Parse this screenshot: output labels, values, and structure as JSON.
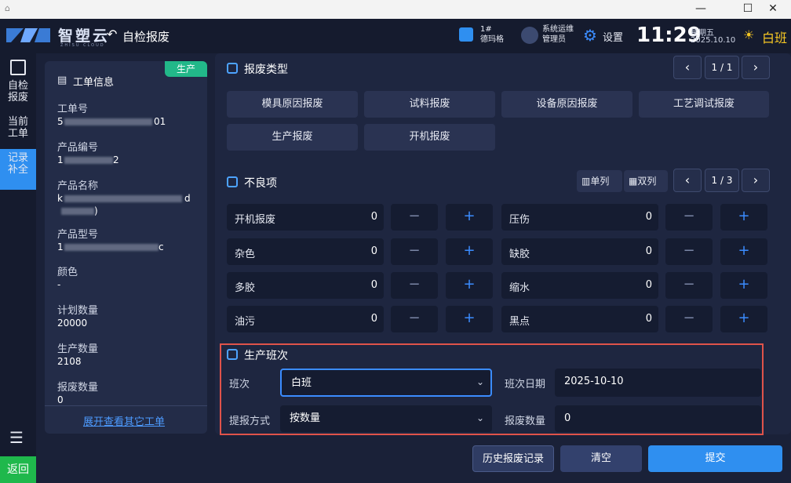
{
  "app": {
    "name": "智塑云",
    "name_sub": "ZHISU CLOUD",
    "page_title": "自检报废"
  },
  "header": {
    "machine_no": "1#",
    "machine_name": "德玛格",
    "user_name": "系统运维",
    "user_role": "管理员",
    "settings_label": "设置",
    "time": "11:29",
    "weekday": "星期五",
    "date": "2025.10.10",
    "shift": "白班"
  },
  "nav": {
    "items": [
      {
        "label_line1": "自检",
        "label_line2": "报废"
      },
      {
        "label_line1": "当前",
        "label_line2": "工单"
      },
      {
        "label_line1": "记录",
        "label_line2": "补全"
      }
    ],
    "return_label": "返回"
  },
  "info": {
    "title": "工单信息",
    "badge": "生产",
    "fields": [
      {
        "label": "工单号",
        "value_prefix": "5",
        "value_suffix": "01"
      },
      {
        "label": "产品编号",
        "value_prefix": "1",
        "value_suffix": "2"
      },
      {
        "label": "产品名称",
        "value_prefix": "k",
        "value_suffix": "d",
        "value_line2_suffix": ")"
      },
      {
        "label": "产品型号",
        "value_prefix": "1",
        "value_suffix": "c"
      },
      {
        "label": "颜色",
        "value": "-"
      },
      {
        "label": "计划数量",
        "value": "20000"
      },
      {
        "label": "生产数量",
        "value": "2108"
      },
      {
        "label": "报废数量",
        "value": "0"
      }
    ],
    "expand_link": "展开查看其它工单"
  },
  "scrap_type": {
    "title": "报废类型",
    "pager": "1 / 1",
    "types": [
      "模具原因报废",
      "试料报废",
      "设备原因报废",
      "工艺调试报废",
      "生产报废",
      "开机报废"
    ]
  },
  "defects": {
    "title": "不良项",
    "single_col_label": "单列",
    "double_col_label": "双列",
    "pager": "1 / 3",
    "items": [
      {
        "name": "开机报废",
        "count": "0"
      },
      {
        "name": "压伤",
        "count": "0"
      },
      {
        "name": "杂色",
        "count": "0"
      },
      {
        "name": "缺胶",
        "count": "0"
      },
      {
        "name": "多胶",
        "count": "0"
      },
      {
        "name": "缩水",
        "count": "0"
      },
      {
        "name": "油污",
        "count": "0"
      },
      {
        "name": "黑点",
        "count": "0"
      }
    ],
    "minus": "−",
    "plus": "+"
  },
  "shift_form": {
    "title": "生产班次",
    "shift_label": "班次",
    "shift_value": "白班",
    "date_label": "班次日期",
    "date_value": "2025-10-10",
    "method_label": "提报方式",
    "method_value": "按数量",
    "qty_label": "报废数量",
    "qty_value": "0"
  },
  "actions": {
    "history": "历史报废记录",
    "clear": "清空",
    "submit": "提交"
  },
  "colors": {
    "accent": "#2f8ff0",
    "submit": "#2f8ff0",
    "return": "#1fb84c",
    "badge": "#22b889",
    "highlight_border": "#e0534a",
    "shift_text": "#f5c623"
  }
}
